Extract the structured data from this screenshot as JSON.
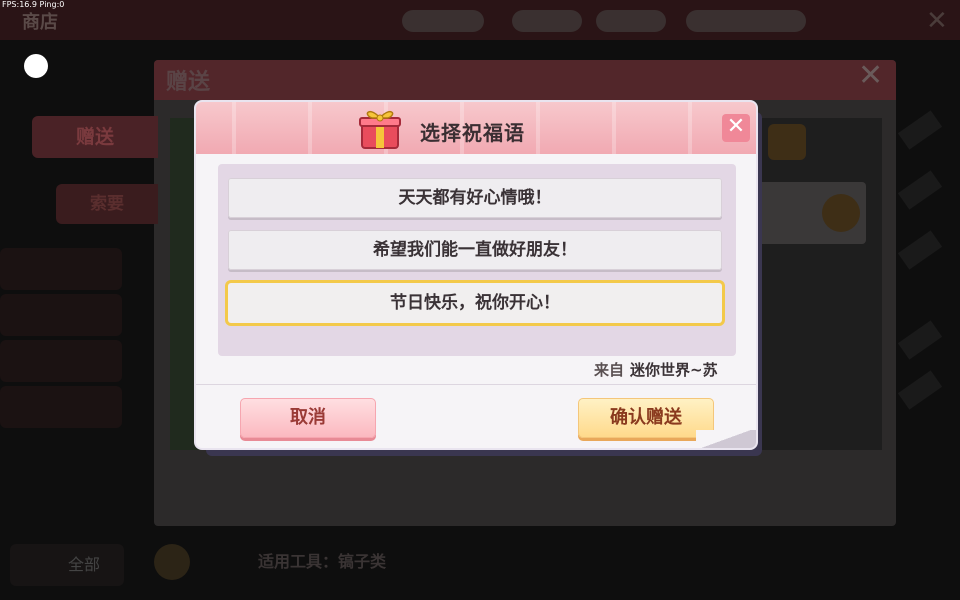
{
  "hud": {
    "fps": "FPS:16.9  Ping:0"
  },
  "shop": {
    "title": "商店",
    "all_label": "全部",
    "tool_hint": "适用工具：镐子类"
  },
  "gift_window": {
    "title": "赠送",
    "send_tab": "赠送",
    "ask_tab": "索要"
  },
  "dialog": {
    "title": "选择祝福语",
    "close": "✕",
    "options": [
      "天天都有好心情哦！",
      "希望我们能一直做好朋友！",
      "节日快乐，祝你开心！"
    ],
    "selected_index": 2,
    "from_label": "来自",
    "from_name": "迷你世界~苏",
    "cancel": "取消",
    "confirm": "确认赠送"
  },
  "colors": {
    "header_pink": "#f1a9b2",
    "selected_border": "#f3c94a",
    "confirm_yellow": "#ffd98a",
    "cancel_pink": "#fbb8bf"
  },
  "icons": [
    "gift-icon",
    "close-icon",
    "search-icon"
  ]
}
